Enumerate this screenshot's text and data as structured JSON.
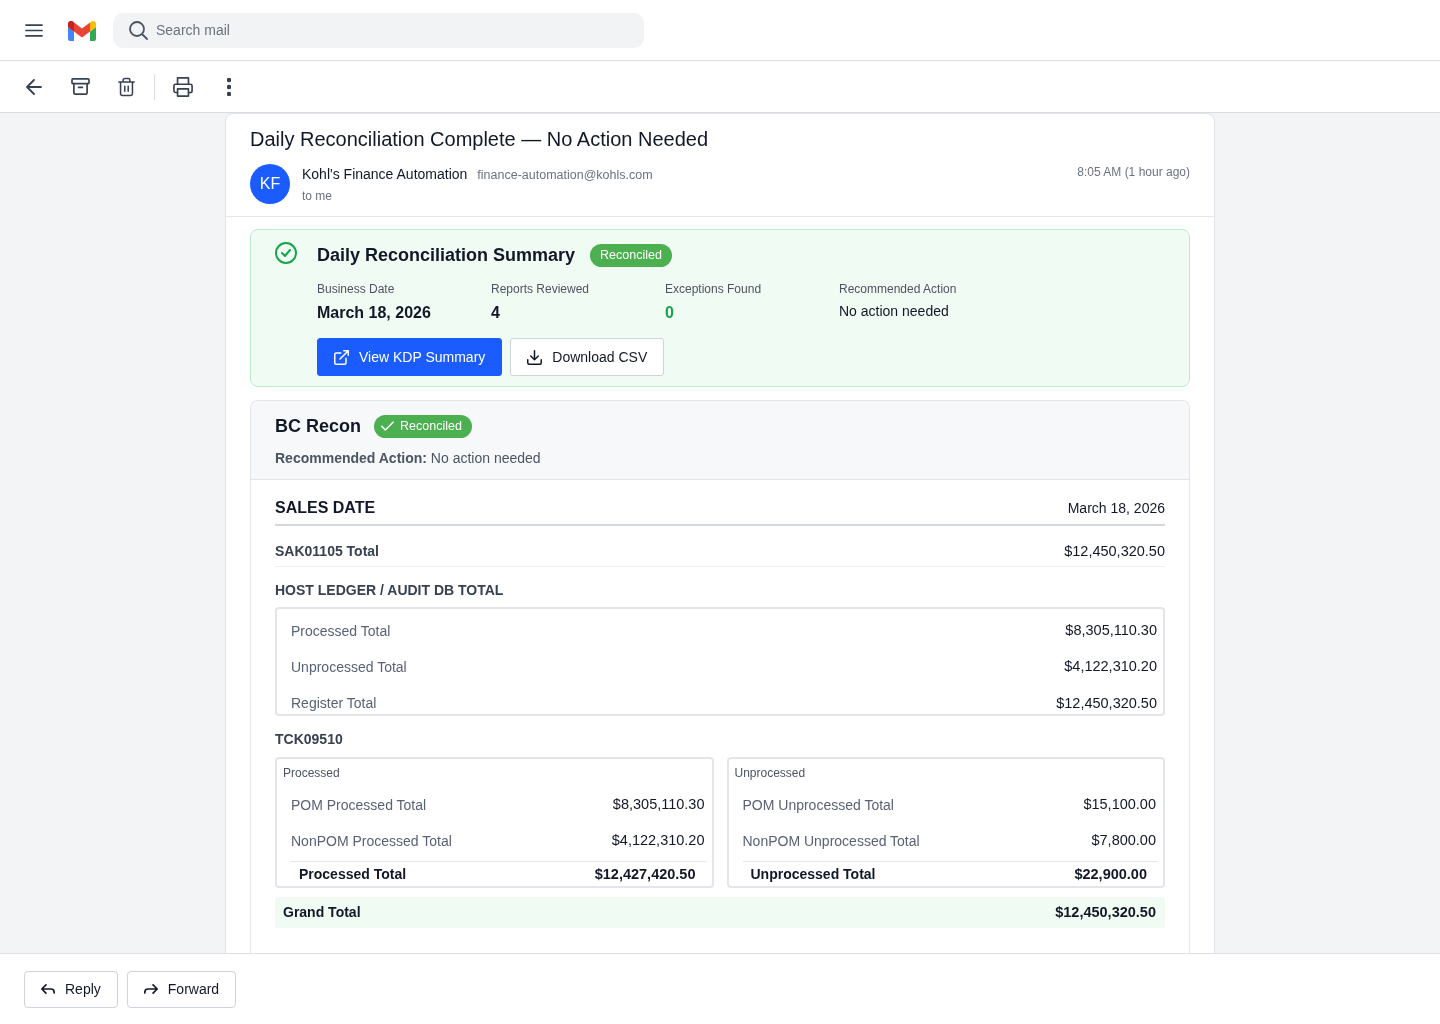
{
  "header": {
    "search": {
      "placeholder": "Search mail"
    }
  },
  "email": {
    "subject": "Daily Reconciliation Complete — No Action Needed",
    "sender": {
      "initials": "KF",
      "name": "Kohl's Finance Automation",
      "address": "finance-automation@kohls.com",
      "recipient": "to me"
    },
    "time": "8:05 AM (1 hour ago)",
    "summary": {
      "title": "Daily Reconciliation Summary",
      "status": "Reconciled",
      "stats": [
        {
          "label": "Business Date",
          "value": "March 18, 2026",
          "kind": "figure"
        },
        {
          "label": "Reports Reviewed",
          "value": "4",
          "kind": "figure"
        },
        {
          "label": "Exceptions Found",
          "value": "0",
          "kind": "success"
        },
        {
          "label": "Recommended Action",
          "value": "No action needed",
          "kind": "note"
        }
      ],
      "buttons": [
        {
          "label": "View KDP Summary",
          "kind": "open"
        },
        {
          "label": "Download CSV",
          "kind": "download"
        }
      ]
    },
    "recon": {
      "title": "BC Recon",
      "status": "Reconciled",
      "action": "**Recommended Action:** No action needed",
      "sales_date": {
        "label": "SALES DATE",
        "value": "March 18, 2026"
      },
      "source_total": {
        "label": "SAK01105 Total",
        "value": "$12,450,320.50"
      },
      "host_ledger": {
        "title": "HOST LEDGER / AUDIT DB TOTAL",
        "rows": [
          {
            "label": "Processed Total",
            "value": "$8,305,110.30"
          },
          {
            "label": "Unprocessed Total",
            "value": "$4,122,310.20"
          },
          {
            "label": "Register Total",
            "value": "$12,450,320.50"
          }
        ]
      },
      "terminal": {
        "title": "TCK09510",
        "groups": [
          {
            "title": "Processed",
            "rows": [
              {
                "label": "POM Processed Total",
                "value": "$8,305,110.30"
              },
              {
                "label": "NonPOM Processed Total",
                "value": "$4,122,310.20"
              }
            ],
            "total": {
              "label": "Processed Total",
              "value": "$12,427,420.50"
            }
          },
          {
            "title": "Unprocessed",
            "rows": [
              {
                "label": "POM Unprocessed Total",
                "value": "$15,100.00"
              },
              {
                "label": "NonPOM Unprocessed Total",
                "value": "$7,800.00"
              }
            ],
            "total": {
              "label": "Unprocessed Total",
              "value": "$22,900.00"
            }
          }
        ]
      },
      "grand_total": {
        "label": "Grand Total",
        "value": "$12,450,320.50"
      }
    }
  },
  "footer": {
    "buttons": [
      {
        "label": "Reply",
        "kind": "reply"
      },
      {
        "label": "Forward",
        "kind": "forward"
      }
    ]
  }
}
